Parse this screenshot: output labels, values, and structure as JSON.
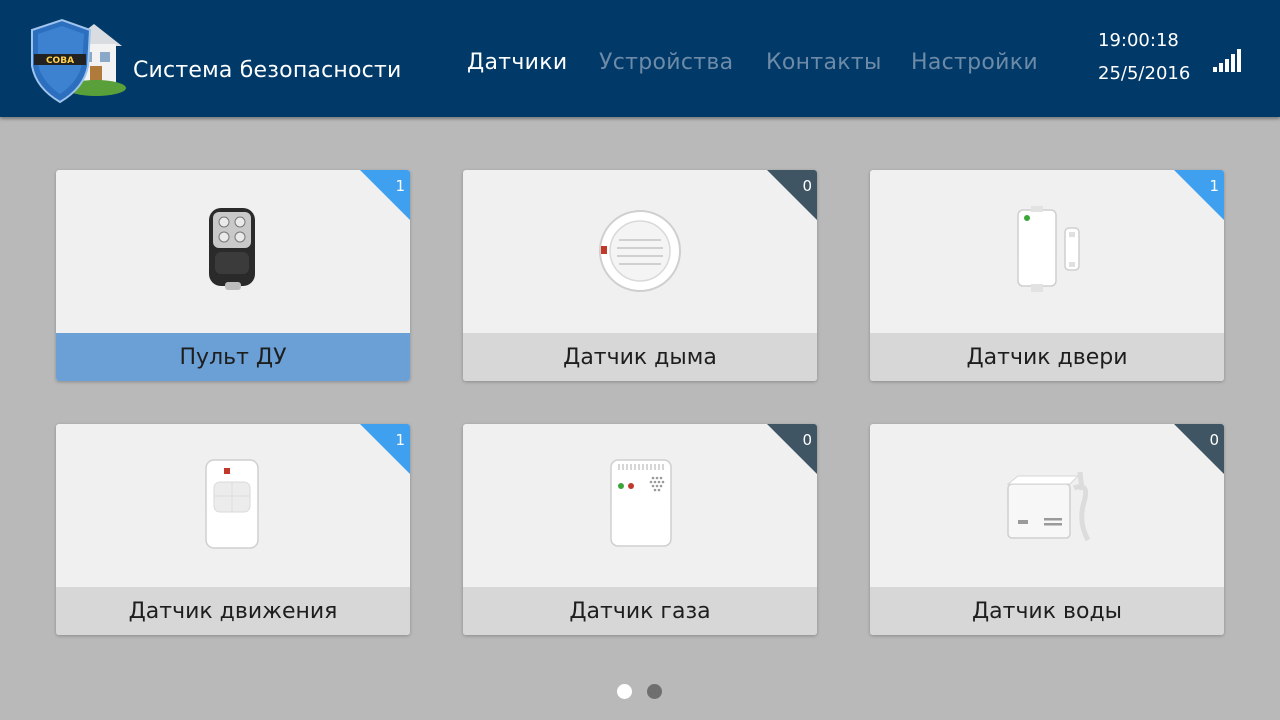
{
  "app": {
    "title": "Система безопасности",
    "logo_text": "СОВА"
  },
  "nav": {
    "tabs": [
      {
        "label": "Датчики",
        "active": true
      },
      {
        "label": "Устройства",
        "active": false
      },
      {
        "label": "Контакты",
        "active": false
      },
      {
        "label": "Настройки",
        "active": false
      }
    ]
  },
  "status": {
    "time": "19:00:18",
    "date": "25/5/2016",
    "signal_icon": "signal-bars-icon"
  },
  "sensors": [
    {
      "label": "Пульт ДУ",
      "count": "1",
      "selected": true,
      "icon": "remote-control-icon"
    },
    {
      "label": "Датчик дыма",
      "count": "0",
      "selected": false,
      "icon": "smoke-detector-icon"
    },
    {
      "label": "Датчик двери",
      "count": "1",
      "selected": false,
      "icon": "door-sensor-icon"
    },
    {
      "label": "Датчик движения",
      "count": "1",
      "selected": false,
      "icon": "motion-sensor-icon"
    },
    {
      "label": "Датчик газа",
      "count": "0",
      "selected": false,
      "icon": "gas-detector-icon"
    },
    {
      "label": "Датчик воды",
      "count": "0",
      "selected": false,
      "icon": "water-sensor-icon"
    }
  ],
  "pager": {
    "pages": 2,
    "current": 1
  },
  "colors": {
    "header": "#013a68",
    "background": "#b9b9b9",
    "selected_label": "#6aa0d6",
    "badge_active": "#3ea0ee",
    "badge_zero": "#3f5563"
  }
}
